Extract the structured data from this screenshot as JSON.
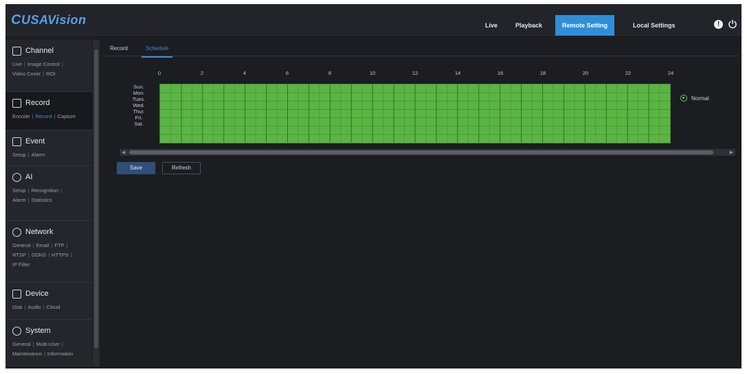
{
  "brand": {
    "logo_text": "USAVision",
    "logo_mark": "C"
  },
  "topnav": {
    "items": [
      {
        "label": "Live",
        "active": false
      },
      {
        "label": "Playback",
        "active": false
      },
      {
        "label": "Remote Setting",
        "active": true
      },
      {
        "label": "Local Settings",
        "active": false
      }
    ],
    "info_icon": "!",
    "power_icon": "power-icon"
  },
  "sidebar": {
    "sections": [
      {
        "title": "Channel",
        "icon": "monitor-icon",
        "links": [
          "Live",
          "Image Control",
          "Video Cover",
          "ROI"
        ]
      },
      {
        "title": "Record",
        "icon": "record-icon",
        "active": true,
        "links": [
          "Encode",
          "Record",
          "Capture"
        ],
        "active_link": "Record"
      },
      {
        "title": "Event",
        "icon": "event-icon",
        "links": [
          "Setup",
          "Alarm"
        ]
      },
      {
        "title": "AI",
        "icon": "ai-icon",
        "links": [
          "Setup",
          "Recognition",
          "Alarm",
          "Statistics"
        ]
      },
      {
        "title": "Network",
        "icon": "network-icon",
        "links": [
          "General",
          "Email",
          "FTP",
          "RTSP",
          "DDNS",
          "HTTPS",
          "IP Filter"
        ]
      },
      {
        "title": "Device",
        "icon": "device-icon",
        "links": [
          "Disk",
          "Audio",
          "Cloud"
        ]
      },
      {
        "title": "System",
        "icon": "system-icon",
        "links": [
          "General",
          "Multi-User",
          "Maintenance",
          "Information"
        ]
      }
    ]
  },
  "tabs": [
    {
      "label": "Record",
      "active": false
    },
    {
      "label": "Schedule",
      "active": true
    }
  ],
  "schedule": {
    "hour_labels": [
      "0",
      "2",
      "4",
      "6",
      "8",
      "10",
      "12",
      "14",
      "16",
      "18",
      "20",
      "22",
      "24"
    ],
    "days": [
      "Sun.",
      "Mon.",
      "Tues.",
      "Wed.",
      "Thur.",
      "Fri.",
      "Sat."
    ],
    "mode": "Normal",
    "mode_color": "#5bb544"
  },
  "buttons": {
    "save": "Save",
    "refresh": "Refresh"
  }
}
